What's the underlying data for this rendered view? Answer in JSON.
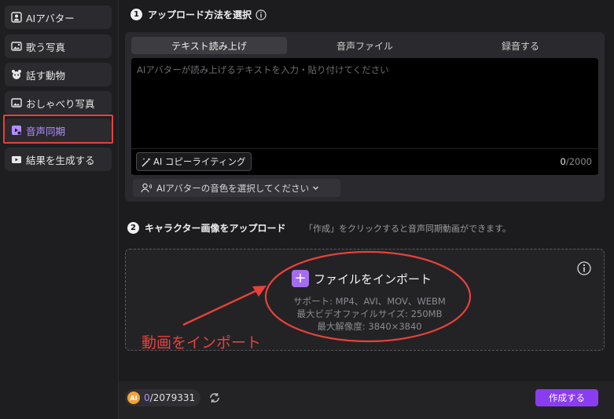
{
  "sidebar": {
    "items": [
      {
        "label": "AIアバター",
        "icon": "avatar-icon"
      },
      {
        "label": "歌う写真",
        "icon": "singing-photo-icon"
      },
      {
        "label": "話す動物",
        "icon": "animal-icon"
      },
      {
        "label": "おしゃべり写真",
        "icon": "talking-photo-icon"
      },
      {
        "label": "音声同期",
        "icon": "lip-sync-icon",
        "active": true
      },
      {
        "label": "結果を生成する",
        "icon": "result-icon"
      }
    ]
  },
  "step1": {
    "number": "1",
    "title": "アップロード方法を選択",
    "tabs": [
      {
        "label": "テキスト読み上げ",
        "active": true
      },
      {
        "label": "音声ファイル"
      },
      {
        "label": "録音する"
      }
    ],
    "text_placeholder": "AIアバターが読み上げるテキストを入力・貼り付けてください",
    "ai_copy_label": "AI コピーライティング",
    "char_count": "0",
    "char_limit": "/2000",
    "voice_select_label": "AIアバターの音色を選択してください"
  },
  "step2": {
    "number": "2",
    "title": "キャラクター画像をアップロード",
    "hint": "「作成」をクリックすると音声同期動画ができます。",
    "import_label": "ファイルをインポート",
    "support_formats": "サポート: MP4、AVI、MOV、WEBM",
    "max_size": "最大ビデオファイルサイズ: 250MB",
    "max_resolution": "最大解像度:  3840×3840"
  },
  "annotation": {
    "text": "動画をインポート",
    "color": "#e8413a"
  },
  "footer": {
    "coin_label": "AI",
    "credits_used": "0",
    "credits_total": "/2079331",
    "create_label": "作成する"
  },
  "colors": {
    "accent": "#8a3cf0",
    "active_text": "#b38cff",
    "annotation": "#e8413a"
  }
}
